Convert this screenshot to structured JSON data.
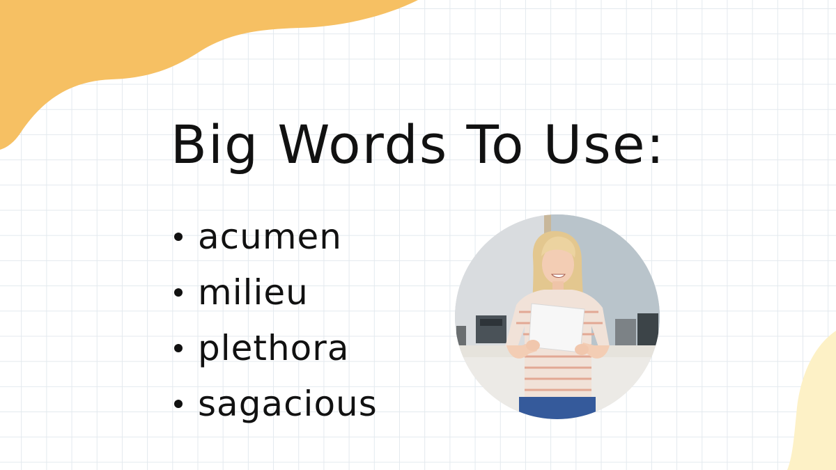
{
  "slide": {
    "title": "Big Words To Use:",
    "words": [
      "acumen",
      "milieu",
      "plethora",
      "sagacious"
    ]
  },
  "colors": {
    "accent_blob": "#f6c063",
    "accent_blob_light": "#fdf1c6",
    "grid_line": "#e3e9ee",
    "text": "#111111"
  },
  "photo": {
    "icon": "person-reading-paper-photo"
  }
}
